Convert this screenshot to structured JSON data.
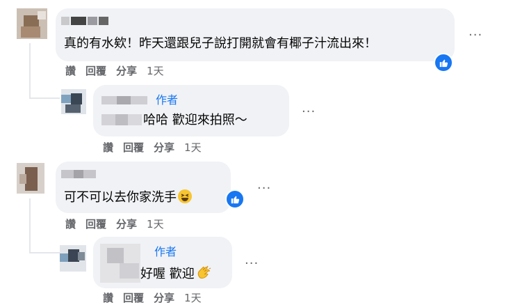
{
  "comments": [
    {
      "text": "真的有水欸！昨天還跟兒子說打開就會有椰子汁流出來！",
      "actions": {
        "read": "讚",
        "reply": "回覆",
        "share": "分享",
        "time": "1天"
      },
      "reply": {
        "author_badge": "作者",
        "text": "哈哈 歡迎來拍照～",
        "actions": {
          "read": "讚",
          "reply": "回覆",
          "share": "分享",
          "time": "1天"
        }
      }
    },
    {
      "text": "可不可以去你家洗手",
      "emoji": "grinning-squinting-emoji",
      "actions": {
        "read": "讚",
        "reply": "回覆",
        "share": "分享",
        "time": "1天"
      },
      "reply": {
        "author_badge": "作者",
        "text": "好喔 歡迎",
        "emoji": "clapping-hands-emoji",
        "actions": {
          "read": "讚",
          "reply": "回覆",
          "share": "分享",
          "time": "1天"
        }
      }
    }
  ],
  "more_glyph": "···",
  "colors": {
    "bubble": "#f0f2f5",
    "link_blue": "#1877f2",
    "meta_gray": "#65676b"
  }
}
